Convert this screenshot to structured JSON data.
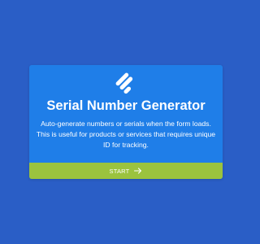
{
  "colors": {
    "page_background": "#2a5ec6",
    "card_background": "#1f7ee8",
    "button_background": "#9bc33e",
    "text": "#ffffff"
  },
  "card": {
    "icon": "serial-number-logo-icon",
    "title": "Serial Number Generator",
    "description": "Auto-generate numbers or serials when the form loads. This is useful for products or services that requires unique ID for tracking.",
    "start_label": "START",
    "start_icon": "arrow-right-icon"
  }
}
